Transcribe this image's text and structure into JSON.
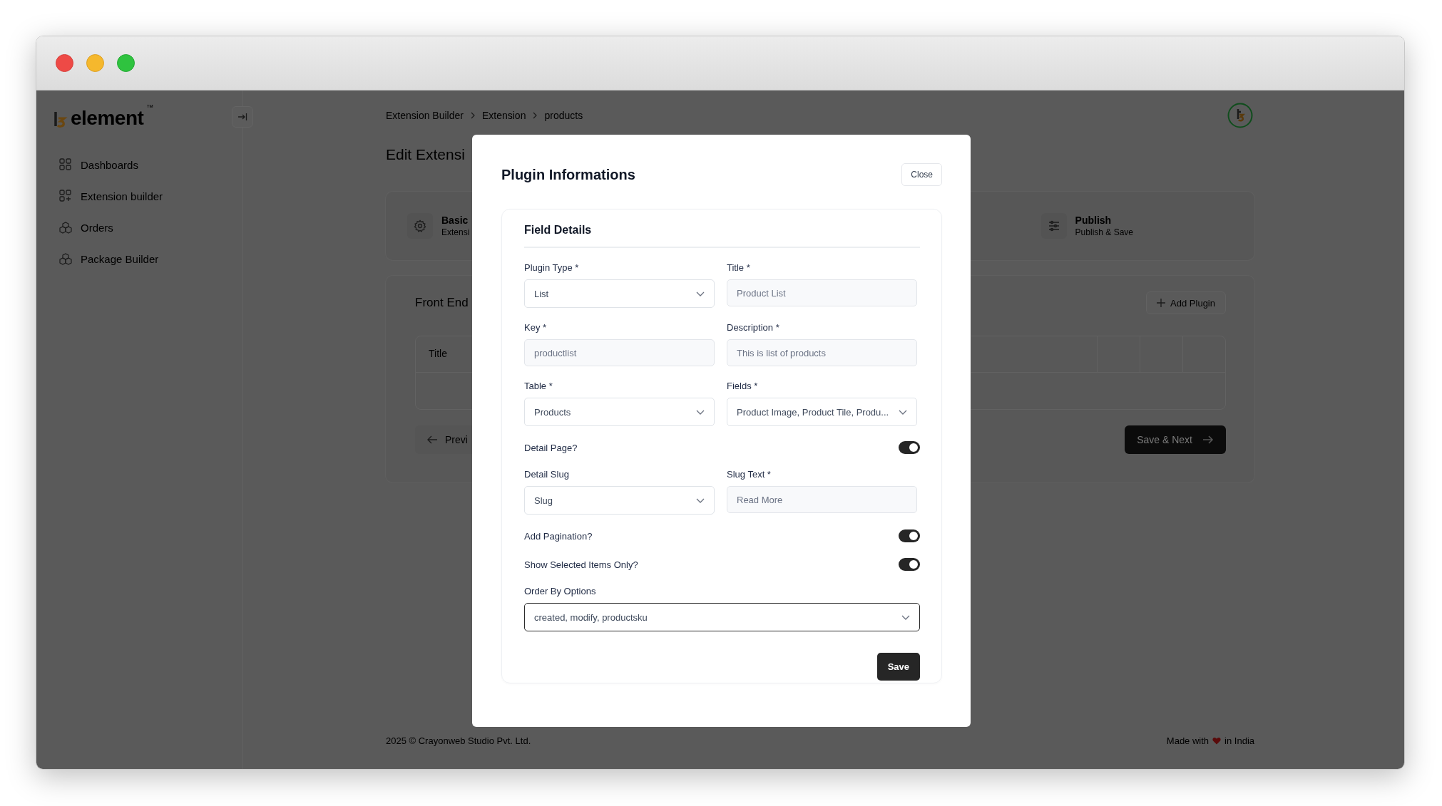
{
  "sidebar": {
    "logo": {
      "text": "element",
      "mark": "™"
    },
    "items": [
      {
        "label": "Dashboards"
      },
      {
        "label": "Extension builder"
      },
      {
        "label": "Orders"
      },
      {
        "label": "Package Builder"
      }
    ]
  },
  "breadcrumb": [
    "Extension Builder",
    "Extension",
    "products"
  ],
  "page_title": "Edit Extensi",
  "steps": [
    {
      "title": "Basic",
      "subtitle": "Extensi"
    },
    {
      "title": "Publish",
      "subtitle": "Publish & Save"
    }
  ],
  "section": {
    "title": "Front End",
    "add_button": "Add Plugin",
    "table": {
      "columns": [
        "Title"
      ]
    },
    "previous_button": "Previ",
    "next_button": "Save & Next"
  },
  "footer": {
    "copyright": "2025 ©  Crayonweb Studio Pvt. Ltd.",
    "made_with": "Made with",
    "made_in": "in India"
  },
  "modal": {
    "title": "Plugin Informations",
    "close_button": "Close",
    "card": {
      "title": "Field Details",
      "rows": [
        {
          "fields": [
            {
              "kind": "select",
              "label": "Plugin Type *",
              "value": "List",
              "focused": false
            },
            {
              "kind": "input",
              "label": "Title *",
              "placeholder": "Product List"
            }
          ]
        },
        {
          "fields": [
            {
              "kind": "input",
              "label": "Key *",
              "placeholder": "productlist"
            },
            {
              "kind": "input",
              "label": "Description *",
              "placeholder": "This is list of products"
            }
          ]
        },
        {
          "fields": [
            {
              "kind": "select",
              "label": "Table *",
              "value": "Products",
              "focused": false
            },
            {
              "kind": "select",
              "label": "Fields *",
              "value": "Product Image, Product Tile, Produ...",
              "focused": false
            }
          ]
        },
        {
          "fields": [
            {
              "kind": "toggle",
              "label": "Detail Page?",
              "on": true
            }
          ]
        },
        {
          "fields": [
            {
              "kind": "select",
              "label": "Detail Slug",
              "value": "Slug",
              "focused": false
            },
            {
              "kind": "input",
              "label": "Slug Text *",
              "placeholder": "Read More"
            }
          ]
        },
        {
          "fields": [
            {
              "kind": "toggle",
              "label": "Add Pagination?",
              "on": true
            }
          ]
        },
        {
          "fields": [
            {
              "kind": "toggle",
              "label": "Show Selected Items Only?",
              "on": true
            }
          ]
        },
        {
          "fields": [
            {
              "kind": "select",
              "label": "Order By Options",
              "value": "created, modify, productsku",
              "focused": true
            }
          ]
        }
      ]
    },
    "save_button": "Save"
  }
}
